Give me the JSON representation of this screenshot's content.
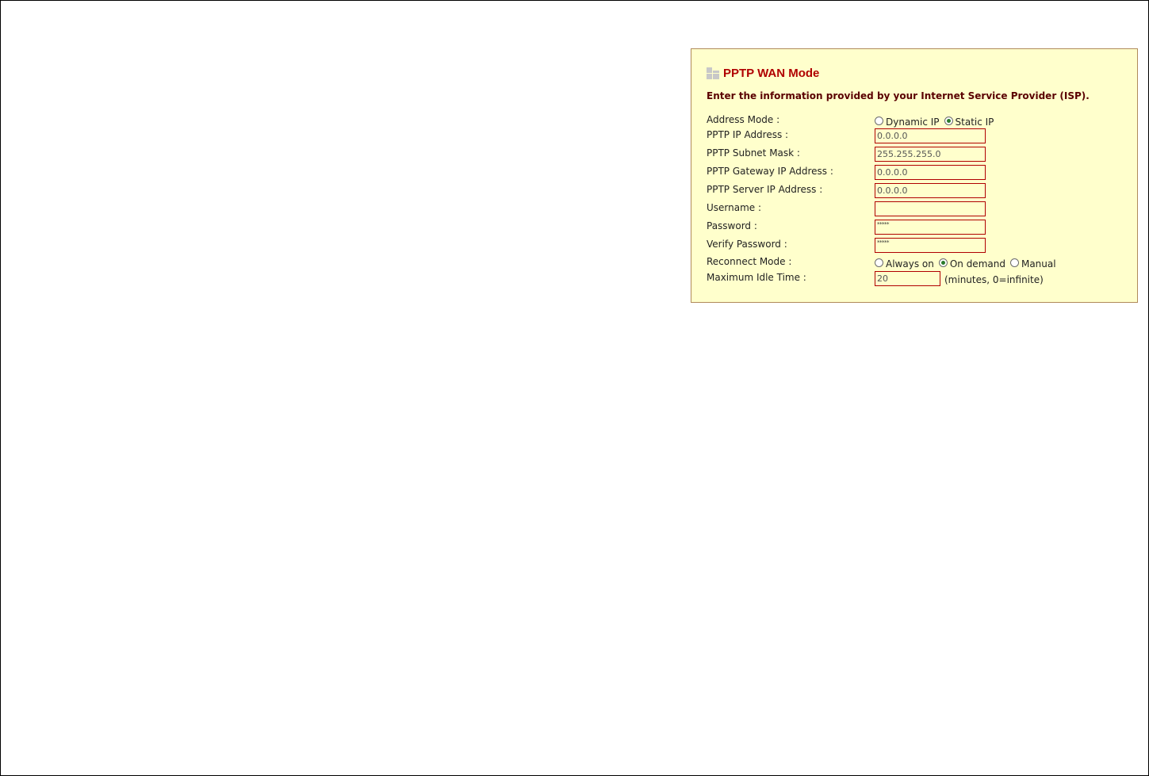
{
  "panel": {
    "title": "PPTP WAN Mode",
    "intro": "Enter the information provided by your Internet Service Provider (ISP)."
  },
  "address_mode": {
    "label": "Address Mode :",
    "options": [
      {
        "label": "Dynamic IP",
        "selected": false
      },
      {
        "label": "Static IP",
        "selected": true
      }
    ]
  },
  "fields": {
    "ip_address": {
      "label": "PPTP IP Address :",
      "value": "0.0.0.0"
    },
    "subnet_mask": {
      "label": "PPTP Subnet Mask :",
      "value": "255.255.255.0"
    },
    "gateway": {
      "label": "PPTP Gateway IP Address :",
      "value": "0.0.0.0"
    },
    "server": {
      "label": "PPTP Server IP Address :",
      "value": "0.0.0.0"
    },
    "username": {
      "label": "Username :",
      "value": ""
    },
    "password": {
      "label": "Password :",
      "value": "*****"
    },
    "verify_password": {
      "label": "Verify Password :",
      "value": "*****"
    }
  },
  "reconnect_mode": {
    "label": "Reconnect Mode :",
    "options": [
      {
        "label": "Always on",
        "selected": false
      },
      {
        "label": "On demand",
        "selected": true
      },
      {
        "label": "Manual",
        "selected": false
      }
    ]
  },
  "idle_time": {
    "label": "Maximum Idle Time :",
    "value": "20",
    "suffix": "(minutes, 0=infinite)"
  },
  "colors": {
    "panel_bg": "#ffffcc",
    "title": "#b00000",
    "field_border": "#b00000",
    "radio_dot": "#2a7a2a"
  }
}
